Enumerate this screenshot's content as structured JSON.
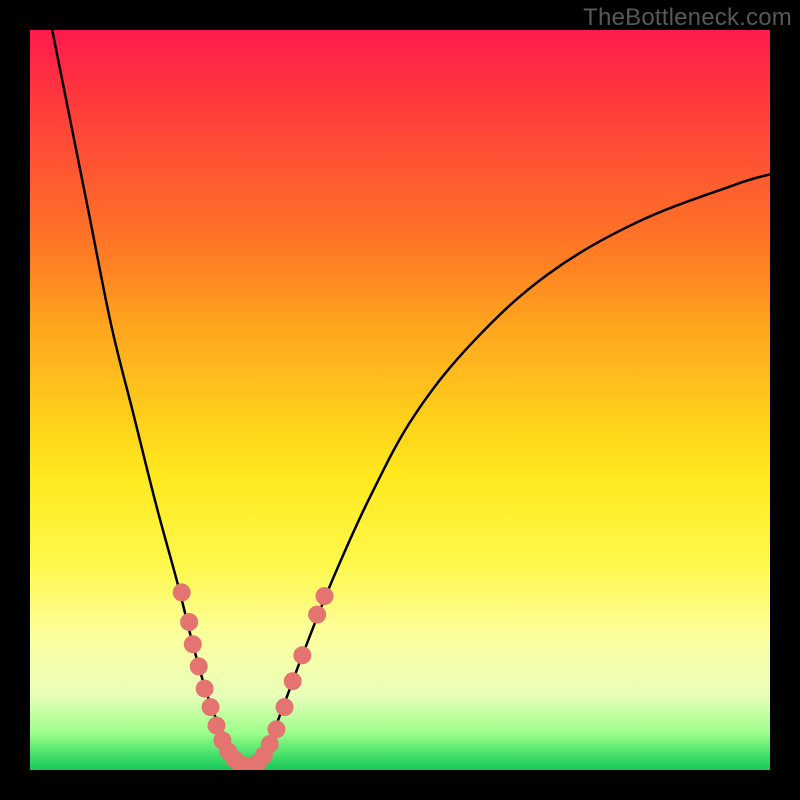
{
  "watermark": "TheBottleneck.com",
  "chart_data": {
    "type": "line",
    "title": "",
    "xlabel": "",
    "ylabel": "",
    "xlim": [
      0,
      100
    ],
    "ylim": [
      0,
      100
    ],
    "main_curve": {
      "name": "bottleneck-curve",
      "color": "#000000",
      "points": [
        {
          "x": 3.0,
          "y": 100.0
        },
        {
          "x": 5.0,
          "y": 90.0
        },
        {
          "x": 8.0,
          "y": 75.0
        },
        {
          "x": 11.0,
          "y": 60.0
        },
        {
          "x": 14.0,
          "y": 48.0
        },
        {
          "x": 17.0,
          "y": 36.0
        },
        {
          "x": 20.0,
          "y": 25.0
        },
        {
          "x": 22.0,
          "y": 17.0
        },
        {
          "x": 24.0,
          "y": 10.0
        },
        {
          "x": 26.0,
          "y": 5.0
        },
        {
          "x": 28.0,
          "y": 1.5
        },
        {
          "x": 29.0,
          "y": 0.5
        },
        {
          "x": 30.0,
          "y": 0.5
        },
        {
          "x": 32.0,
          "y": 3.0
        },
        {
          "x": 34.0,
          "y": 8.0
        },
        {
          "x": 37.0,
          "y": 16.0
        },
        {
          "x": 41.0,
          "y": 26.0
        },
        {
          "x": 46.0,
          "y": 37.0
        },
        {
          "x": 52.0,
          "y": 48.0
        },
        {
          "x": 60.0,
          "y": 58.0
        },
        {
          "x": 70.0,
          "y": 67.0
        },
        {
          "x": 82.0,
          "y": 74.0
        },
        {
          "x": 95.0,
          "y": 79.0
        },
        {
          "x": 100.0,
          "y": 80.5
        }
      ]
    },
    "scatter": {
      "name": "highlight-dots",
      "color": "#e3746f",
      "radius": 9,
      "points": [
        {
          "x": 20.5,
          "y": 24.0
        },
        {
          "x": 21.5,
          "y": 20.0
        },
        {
          "x": 22.0,
          "y": 17.0
        },
        {
          "x": 22.8,
          "y": 14.0
        },
        {
          "x": 23.6,
          "y": 11.0
        },
        {
          "x": 24.4,
          "y": 8.5
        },
        {
          "x": 25.2,
          "y": 6.0
        },
        {
          "x": 26.0,
          "y": 4.0
        },
        {
          "x": 26.8,
          "y": 2.5
        },
        {
          "x": 27.6,
          "y": 1.5
        },
        {
          "x": 28.4,
          "y": 0.8
        },
        {
          "x": 29.2,
          "y": 0.5
        },
        {
          "x": 30.0,
          "y": 0.5
        },
        {
          "x": 30.8,
          "y": 1.0
        },
        {
          "x": 31.6,
          "y": 2.0
        },
        {
          "x": 32.4,
          "y": 3.5
        },
        {
          "x": 33.3,
          "y": 5.5
        },
        {
          "x": 34.4,
          "y": 8.5
        },
        {
          "x": 35.5,
          "y": 12.0
        },
        {
          "x": 36.8,
          "y": 15.5
        },
        {
          "x": 38.8,
          "y": 21.0
        },
        {
          "x": 39.8,
          "y": 23.5
        }
      ]
    }
  }
}
